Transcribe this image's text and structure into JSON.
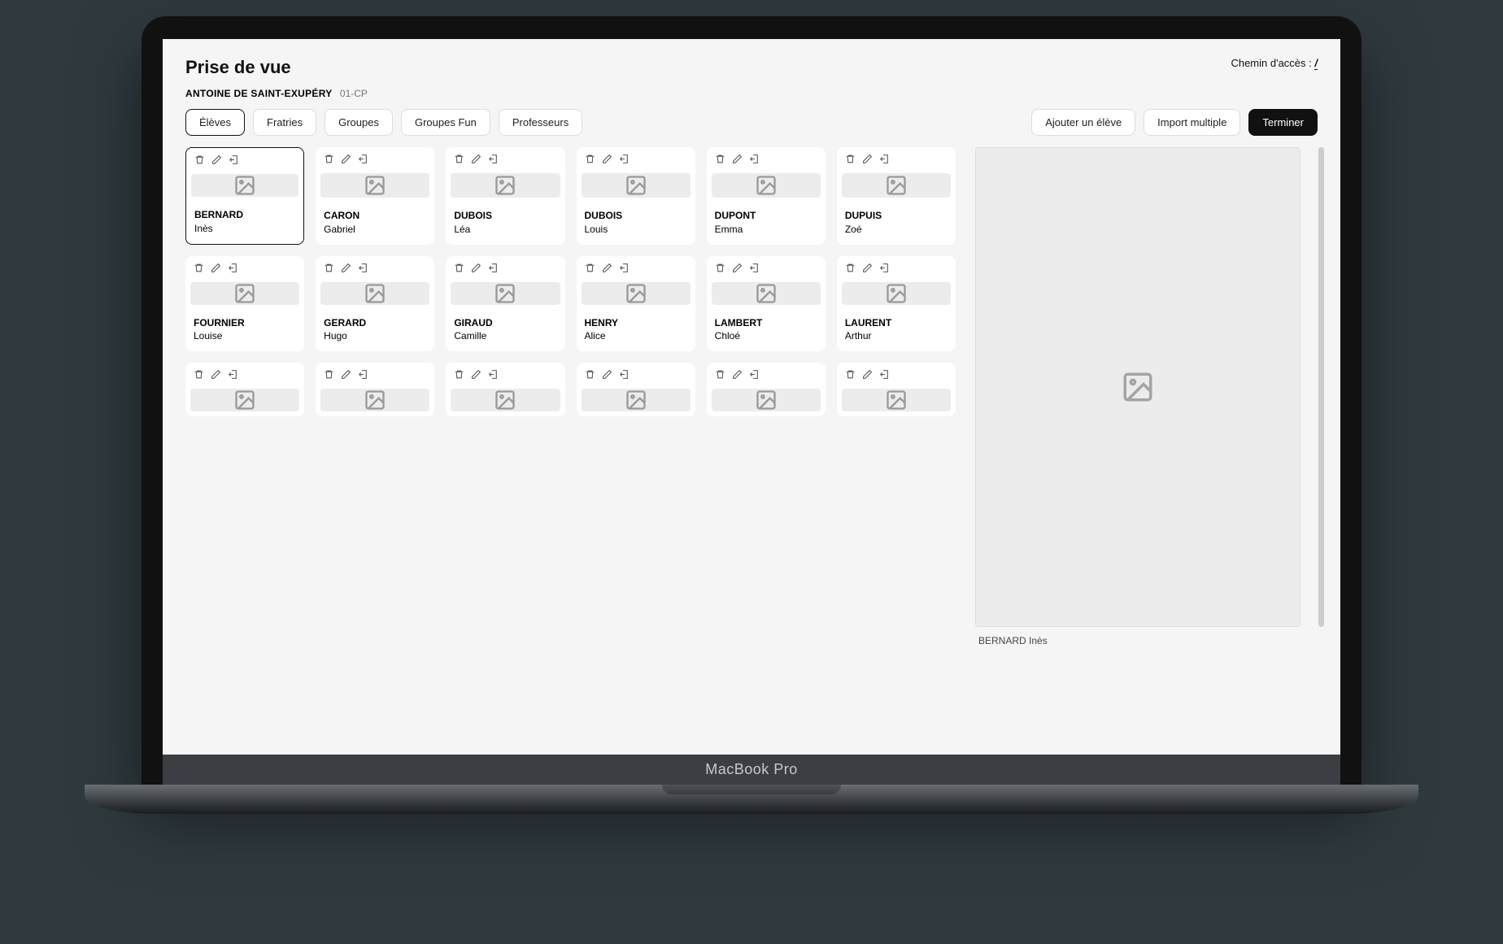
{
  "header": {
    "title": "Prise de vue",
    "breadcrumb_label": "Chemin d'accès : ",
    "breadcrumb_path": "/"
  },
  "subheader": {
    "school": "ANTOINE DE SAINT-EXUPÉRY",
    "class": "01-CP"
  },
  "tabs": {
    "eleves": "Élèves",
    "fratries": "Fratries",
    "groupes": "Groupes",
    "groupes_fun": "Groupes Fun",
    "professeurs": "Professeurs"
  },
  "actions": {
    "add": "Ajouter un élève",
    "import": "Import multiple",
    "finish": "Terminer"
  },
  "brand": "MacBook Pro",
  "preview": {
    "caption": "BERNARD Inès"
  },
  "students": [
    {
      "last": "BERNARD",
      "first": "Inès",
      "selected": true
    },
    {
      "last": "CARON",
      "first": "Gabriel"
    },
    {
      "last": "DUBOIS",
      "first": "Léa"
    },
    {
      "last": "DUBOIS",
      "first": "Louis"
    },
    {
      "last": "DUPONT",
      "first": "Emma"
    },
    {
      "last": "DUPUIS",
      "first": "Zoé"
    },
    {
      "last": "FOURNIER",
      "first": "Louise"
    },
    {
      "last": "GERARD",
      "first": "Hugo"
    },
    {
      "last": "GIRAUD",
      "first": "Camille"
    },
    {
      "last": "HENRY",
      "first": "Alice"
    },
    {
      "last": "LAMBERT",
      "first": "Chloé"
    },
    {
      "last": "LAURENT",
      "first": "Arthur"
    },
    {
      "last": "",
      "first": "",
      "partial": true
    },
    {
      "last": "",
      "first": "",
      "partial": true
    },
    {
      "last": "",
      "first": "",
      "partial": true
    },
    {
      "last": "",
      "first": "",
      "partial": true
    },
    {
      "last": "",
      "first": "",
      "partial": true
    },
    {
      "last": "",
      "first": "",
      "partial": true
    }
  ],
  "icons": {
    "trash": "trash-icon",
    "pencil": "pencil-icon",
    "export": "export-icon",
    "image": "image-placeholder-icon"
  }
}
